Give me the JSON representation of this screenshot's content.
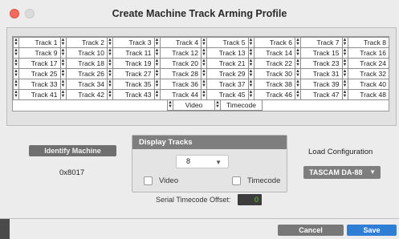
{
  "window": {
    "title": "Create Machine Track Arming Profile"
  },
  "tracks": {
    "rows": [
      [
        "Track 1",
        "Track 2",
        "Track 3",
        "Track 4",
        "Track 5",
        "Track 6",
        "Track 7",
        "Track 8"
      ],
      [
        "Track 9",
        "Track 10",
        "Track 11",
        "Track 12",
        "Track 13",
        "Track 14",
        "Track 15",
        "Track 16"
      ],
      [
        "Track 17",
        "Track 18",
        "Track 19",
        "Track 20",
        "Track 21",
        "Track 22",
        "Track 23",
        "Track 24"
      ],
      [
        "Track 25",
        "Track 26",
        "Track 27",
        "Track 28",
        "Track 29",
        "Track 30",
        "Track 31",
        "Track 32"
      ],
      [
        "Track 33",
        "Track 34",
        "Track 35",
        "Track 36",
        "Track 37",
        "Track 38",
        "Track 39",
        "Track 40"
      ],
      [
        "Track 41",
        "Track 42",
        "Track 43",
        "Track 44",
        "Track 45",
        "Track 46",
        "Track 47",
        "Track 48"
      ]
    ],
    "extra": [
      "Video",
      "Timecode"
    ]
  },
  "identify": {
    "button_label": "Identify Machine",
    "machine_id": "0x8017"
  },
  "display_tracks": {
    "header": "Display Tracks",
    "count": "8",
    "video_label": "Video",
    "timecode_label": "Timecode",
    "video_checked": false,
    "timecode_checked": false
  },
  "serial": {
    "label": "Serial Timecode Offset:",
    "value": "0"
  },
  "load_config": {
    "label": "Load Configuration",
    "selected": "TASCAM DA-88"
  },
  "footer": {
    "cancel_label": "Cancel",
    "save_label": "Save"
  },
  "colors": {
    "save_accent": "#2f7ed6",
    "close_dot": "#f46a5e",
    "offset_value": "#6bd21a"
  }
}
